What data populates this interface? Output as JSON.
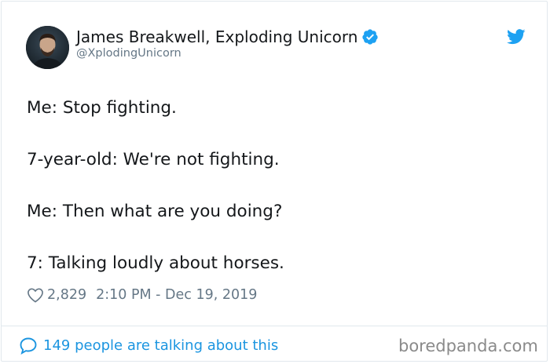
{
  "author": {
    "display_name": "James Breakwell, Exploding Unicorn",
    "handle": "@XplodingUnicorn",
    "verified": true
  },
  "tweet": {
    "lines": [
      "Me: Stop fighting.",
      "7-year-old: We're not fighting.",
      "Me: Then what are you doing?",
      "7: Talking loudly about horses."
    ],
    "likes": "2,829",
    "timestamp": "2:10 PM - Dec 19, 2019"
  },
  "footer": {
    "conversation": "149 people are talking about this"
  },
  "watermark": "boredpanda.com",
  "colors": {
    "text": "#14171a",
    "muted": "#657786",
    "link": "#1b95e0",
    "twitter_blue": "#1da1f2"
  },
  "icons": {
    "verified": "verified-badge-icon",
    "twitter": "twitter-bird-icon",
    "like": "heart-icon",
    "conversation": "speech-bubble-icon"
  }
}
